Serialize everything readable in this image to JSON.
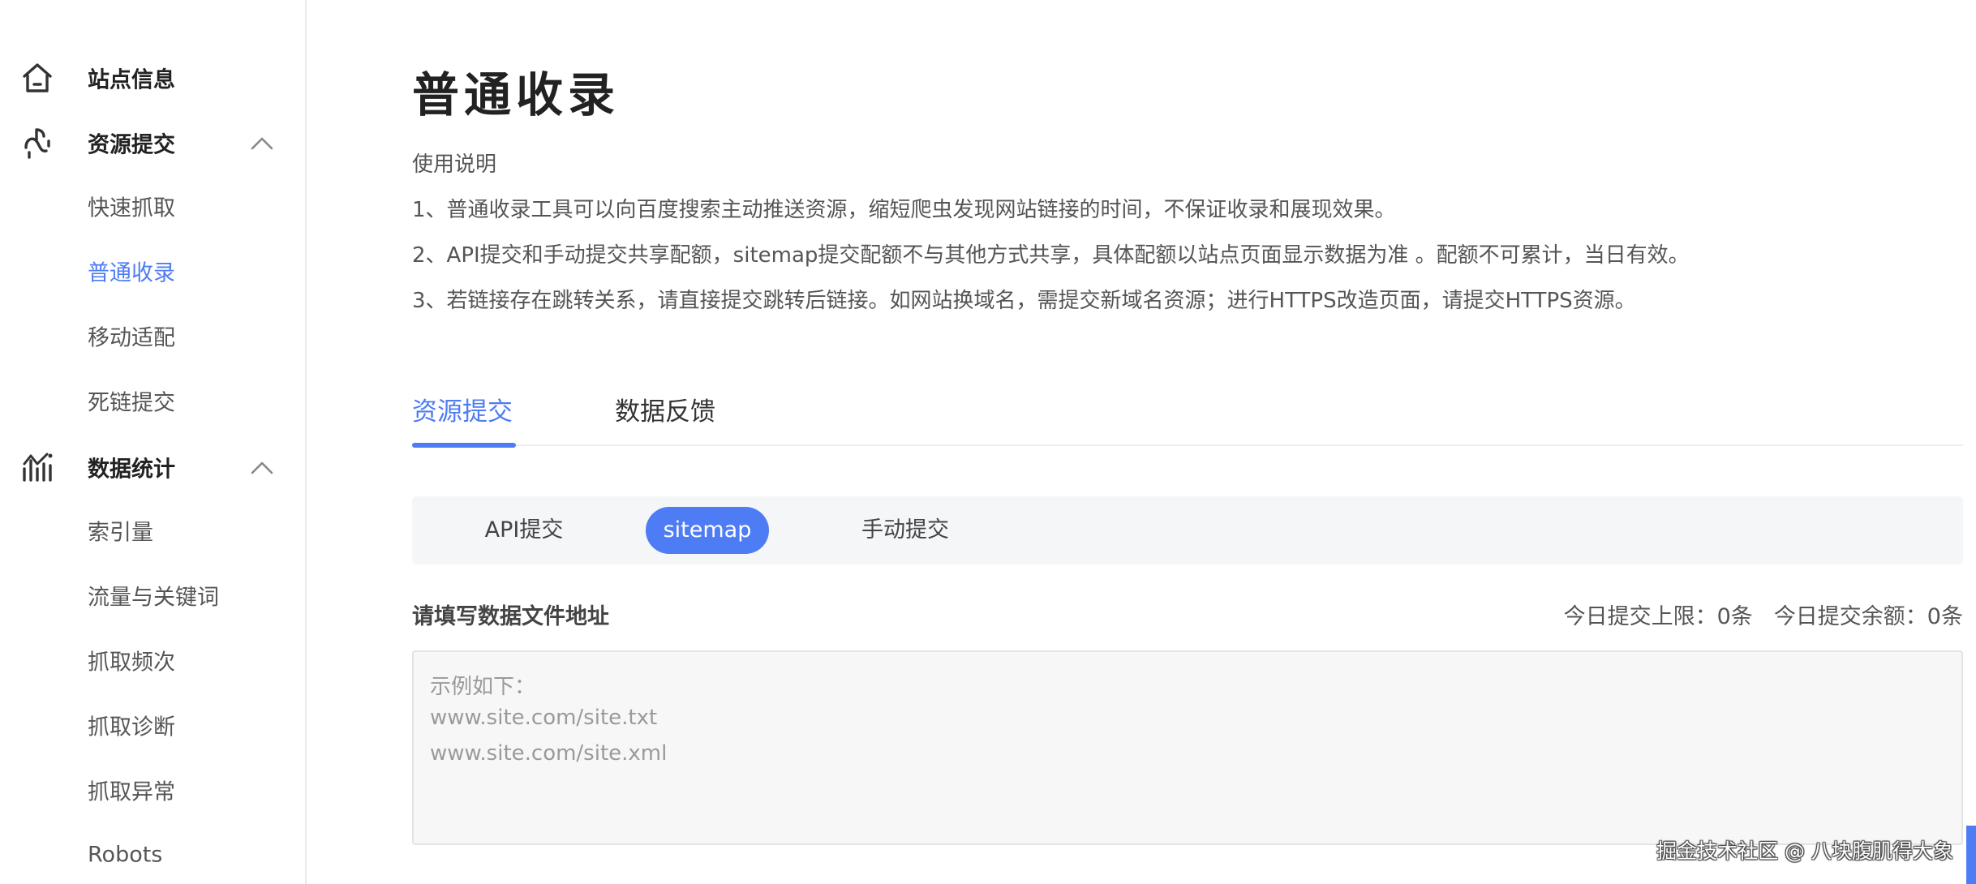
{
  "sidebar": {
    "site_info": "站点信息",
    "resource_submit": "资源提交",
    "resource_items": [
      "快速抓取",
      "普通收录",
      "移动适配",
      "死链提交"
    ],
    "data_stats": "数据统计",
    "stats_items": [
      "索引量",
      "流量与关键词",
      "抓取频次",
      "抓取诊断",
      "抓取异常",
      "Robots"
    ]
  },
  "main": {
    "title": "普通收录",
    "instructions": [
      "使用说明",
      "1、普通收录工具可以向百度搜索主动推送资源，缩短爬虫发现网站链接的时间，不保证收录和展现效果。",
      "2、API提交和手动提交共享配额，sitemap提交配额不与其他方式共享，具体配额以站点页面显示数据为准 。配额不可累计，当日有效。",
      "3、若链接存在跳转关系，请直接提交跳转后链接。如网站换域名，需提交新域名资源；进行HTTPS改造页面，请提交HTTPS资源。"
    ],
    "tabs": [
      "资源提交",
      "数据反馈"
    ],
    "subtabs": [
      "API提交",
      "sitemap",
      "手动提交"
    ],
    "field_label": "请填写数据文件地址",
    "quota_limit": "今日提交上限：0条",
    "quota_remaining": "今日提交余额：0条",
    "placeholder_lines": [
      "示例如下：",
      "www.site.com/site.txt",
      "www.site.com/site.xml"
    ]
  },
  "watermark": "掘金技术社区 @ 八块腹肌得大象",
  "colors": {
    "accent": "#4e7cf4",
    "text_dark": "#222222",
    "text_body": "#555555",
    "subtab_bg": "#f5f6f7",
    "textarea_bg": "#f7f7f7"
  },
  "icons": {
    "site_info": "home-icon",
    "resource_submit": "resource-link-icon",
    "data_stats": "stats-chart-icon",
    "expand": "chevron-up-icon"
  }
}
